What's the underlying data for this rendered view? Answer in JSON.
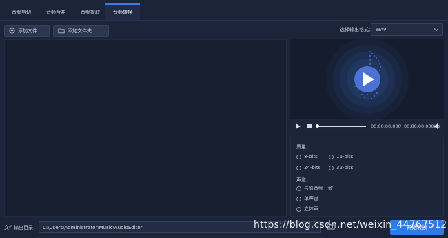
{
  "tabs": [
    {
      "label": "音频剪切",
      "active": false
    },
    {
      "label": "音频合并",
      "active": false
    },
    {
      "label": "音频提取",
      "active": false
    },
    {
      "label": "音频转换",
      "active": true
    }
  ],
  "toolbar": {
    "add_file_label": "添加文件",
    "add_folder_label": "添加文件夹",
    "format_label": "选择输出格式：",
    "format_value": "WAV"
  },
  "player": {
    "current_time": "00:00:00.000",
    "separator": "/",
    "total_time": "00:00:00.000"
  },
  "options": {
    "quality_title": "质量：",
    "quality_options": [
      "8-bits",
      "16-bits",
      "24-bits",
      "32-bits"
    ],
    "channel_title": "声道：",
    "channel_options": [
      "与原音频一致",
      "单声道",
      "立体声"
    ]
  },
  "output": {
    "label": "文件输出目录：",
    "path": "C:\\Users\\Administrator\\Music\\AudioEditor",
    "convert_label": "开始转换"
  },
  "watermark": "https://blog.csdn.net/weixin_44767512",
  "colors": {
    "accent": "#2e7be6",
    "background": "#1b2438",
    "panel": "#161e30"
  },
  "icons": [
    "add-file-icon",
    "folder-icon",
    "music-note-icon",
    "play-icon",
    "stop-icon",
    "volume-icon",
    "chevron-down-icon"
  ]
}
